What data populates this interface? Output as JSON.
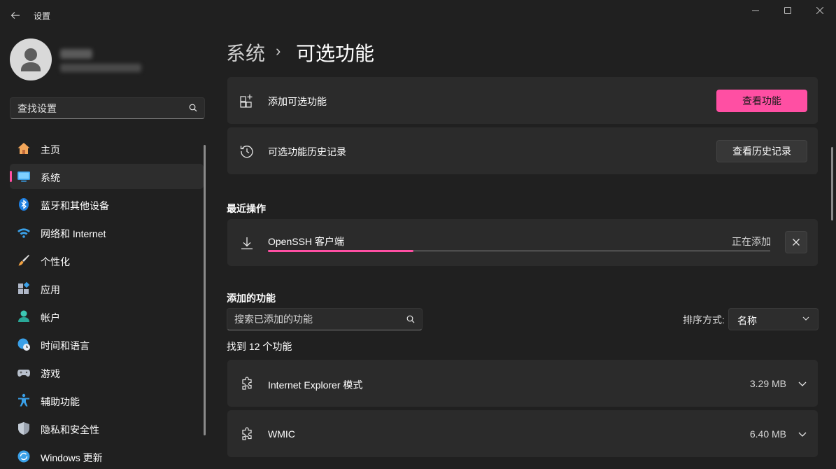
{
  "app": {
    "title": "设置"
  },
  "sidebar": {
    "search_placeholder": "查找设置",
    "items": [
      {
        "label": "主页",
        "icon": "home-icon"
      },
      {
        "label": "系统",
        "icon": "system-display-icon",
        "selected": true
      },
      {
        "label": "蓝牙和其他设备",
        "icon": "bluetooth-icon"
      },
      {
        "label": "网络和 Internet",
        "icon": "wifi-icon"
      },
      {
        "label": "个性化",
        "icon": "paintbrush-icon"
      },
      {
        "label": "应用",
        "icon": "apps-icon"
      },
      {
        "label": "帐户",
        "icon": "account-icon"
      },
      {
        "label": "时间和语言",
        "icon": "globe-clock-icon"
      },
      {
        "label": "游戏",
        "icon": "gamepad-icon"
      },
      {
        "label": "辅助功能",
        "icon": "accessibility-icon"
      },
      {
        "label": "隐私和安全性",
        "icon": "shield-icon"
      },
      {
        "label": "Windows 更新",
        "icon": "update-icon"
      }
    ]
  },
  "header": {
    "parent": "系统",
    "separator": "›",
    "current": "可选功能"
  },
  "add_feature": {
    "label": "添加可选功能",
    "button": "查看功能",
    "icon": "add-grid-icon"
  },
  "history": {
    "label": "可选功能历史记录",
    "button": "查看历史记录",
    "icon": "history-icon"
  },
  "recent": {
    "heading": "最近操作",
    "item": {
      "name": "OpenSSH 客户端",
      "status": "正在添加",
      "progress": 0.29,
      "icon": "download-icon"
    }
  },
  "added": {
    "heading": "添加的功能",
    "search_placeholder": "搜索已添加的功能",
    "sort_label": "排序方式:",
    "sort_value": "名称",
    "count_text": "找到 12 个功能",
    "features": [
      {
        "name": "Internet Explorer 模式",
        "size": "3.29 MB",
        "icon": "puzzle-icon"
      },
      {
        "name": "WMIC",
        "size": "6.40 MB",
        "icon": "puzzle-icon"
      }
    ]
  },
  "colors": {
    "accent": "#ff4fa3",
    "background": "#202020",
    "card": "#2b2b2b"
  }
}
